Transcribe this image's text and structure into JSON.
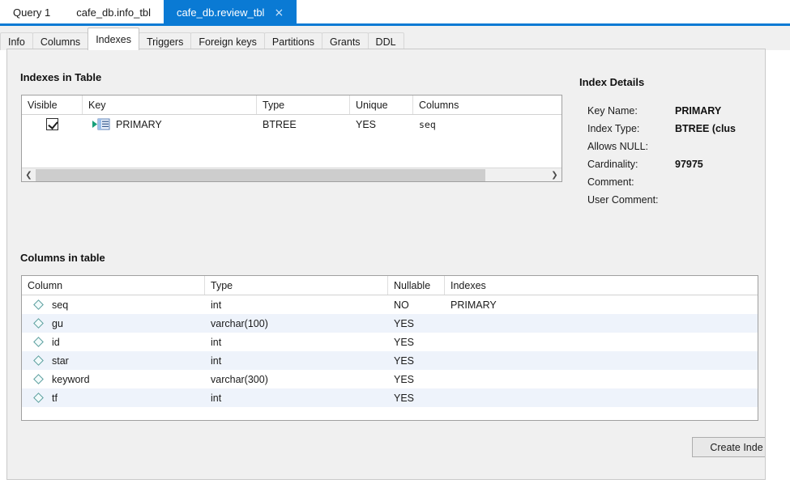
{
  "editor_tabs": [
    {
      "label": "Query 1",
      "active": false,
      "closable": false
    },
    {
      "label": "cafe_db.info_tbl",
      "active": false,
      "closable": false
    },
    {
      "label": "cafe_db.review_tbl",
      "active": true,
      "closable": true,
      "close_glyph": "×"
    }
  ],
  "sub_tabs": [
    {
      "label": "Info",
      "active": false
    },
    {
      "label": "Columns",
      "active": false
    },
    {
      "label": "Indexes",
      "active": true
    },
    {
      "label": "Triggers",
      "active": false
    },
    {
      "label": "Foreign keys",
      "active": false
    },
    {
      "label": "Partitions",
      "active": false
    },
    {
      "label": "Grants",
      "active": false
    },
    {
      "label": "DDL",
      "active": false
    }
  ],
  "indexes_section": {
    "title": "Indexes in Table",
    "columns": [
      "Visible",
      "Key",
      "Type",
      "Unique",
      "Columns"
    ],
    "rows": [
      {
        "visible": true,
        "key": "PRIMARY",
        "type": "BTREE",
        "unique": "YES",
        "columns": "seq"
      }
    ],
    "scrollbar": {
      "left_arrow": "❮",
      "right_arrow": "❯"
    }
  },
  "index_details": {
    "title": "Index Details",
    "fields": [
      {
        "label": "Key Name:",
        "value": "PRIMARY"
      },
      {
        "label": "Index Type:",
        "value": "BTREE (clus"
      },
      {
        "label": "Allows NULL:",
        "value": ""
      },
      {
        "label": "Cardinality:",
        "value": "97975"
      },
      {
        "label": "Comment:",
        "value": ""
      },
      {
        "label": "User Comment:",
        "value": ""
      }
    ]
  },
  "columns_section": {
    "title": "Columns in table",
    "columns": [
      "Column",
      "Type",
      "Nullable",
      "Indexes"
    ],
    "rows": [
      {
        "column": "seq",
        "type": "int",
        "nullable": "NO",
        "indexes": "PRIMARY"
      },
      {
        "column": "gu",
        "type": "varchar(100)",
        "nullable": "YES",
        "indexes": ""
      },
      {
        "column": "id",
        "type": "int",
        "nullable": "YES",
        "indexes": ""
      },
      {
        "column": "star",
        "type": "int",
        "nullable": "YES",
        "indexes": ""
      },
      {
        "column": "keyword",
        "type": "varchar(300)",
        "nullable": "YES",
        "indexes": ""
      },
      {
        "column": "tf",
        "type": "int",
        "nullable": "YES",
        "indexes": ""
      }
    ]
  },
  "footer": {
    "create_index_label": "Create Inde"
  },
  "colors": {
    "accent": "#0a7ad4",
    "panel_bg": "#f0f0f0",
    "grid_bg": "#ffffff",
    "row_alt": "#eef3fb",
    "scroll_thumb": "#cdcdcd",
    "diamond": "#5a9e9e"
  }
}
